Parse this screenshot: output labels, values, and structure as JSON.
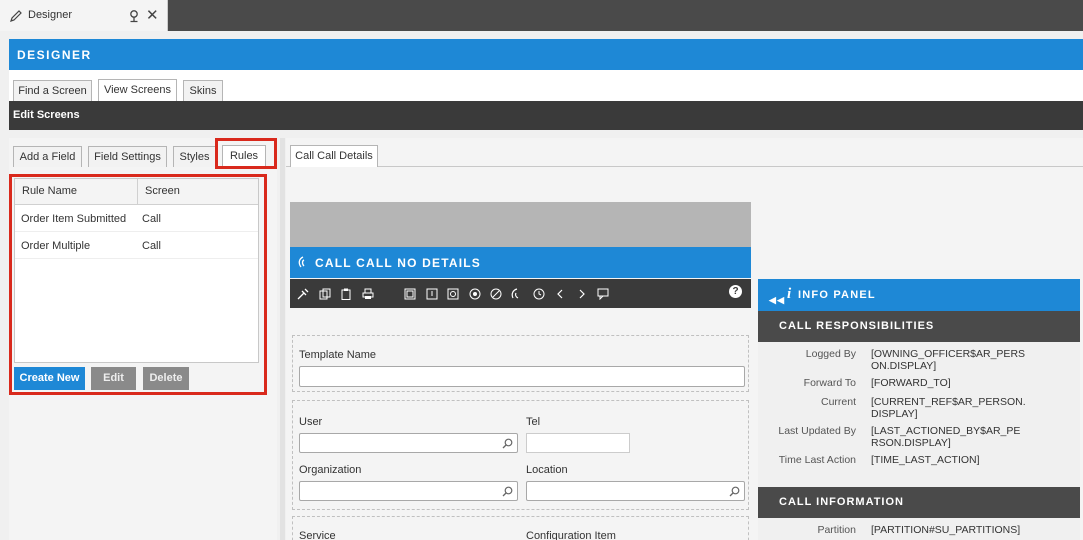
{
  "doc_tab": {
    "title": "Designer",
    "close": "✕"
  },
  "designer": {
    "title": "DESIGNER"
  },
  "main_tabs": [
    {
      "label": "Find a Screen"
    },
    {
      "label": "View Screens"
    },
    {
      "label": "Skins"
    }
  ],
  "edit_bar": {
    "title": "Edit Screens"
  },
  "left_tabs": [
    {
      "label": "Add a Field"
    },
    {
      "label": "Field Settings"
    },
    {
      "label": "Styles"
    },
    {
      "label": "Rules"
    }
  ],
  "rules_grid": {
    "columns": [
      "Rule Name",
      "Screen"
    ],
    "rows": [
      {
        "name": "Order Item Submitted",
        "screen": "Call"
      },
      {
        "name": "Order Multiple",
        "screen": "Call"
      }
    ]
  },
  "buttons": {
    "create": "Create New",
    "edit": "Edit",
    "delete": "Delete"
  },
  "right_tabs": [
    {
      "label": "Call Call Details"
    }
  ],
  "call_panel": {
    "title": "CALL CALL NO DETAILS",
    "help": "?"
  },
  "form": {
    "template_name": "Template Name",
    "user": "User",
    "tel": "Tel",
    "organization": "Organization",
    "location": "Location",
    "service": "Service",
    "configuration_item": "Configuration Item"
  },
  "info_panel": {
    "title": "INFO PANEL",
    "sections": [
      {
        "title": "CALL RESPONSIBILITIES",
        "items": [
          {
            "label": "Logged By",
            "value": "[OWNING_OFFICER$AR_PERSON.DISPLAY]"
          },
          {
            "label": "Forward To",
            "value": "[FORWARD_TO]"
          },
          {
            "label": "Current",
            "value": "[CURRENT_REF$AR_PERSON.DISPLAY]"
          },
          {
            "label": "Last Updated By",
            "value": "[LAST_ACTIONED_BY$AR_PERSON.DISPLAY]"
          },
          {
            "label": "Time Last Action",
            "value": "[TIME_LAST_ACTION]"
          }
        ]
      },
      {
        "title": "CALL INFORMATION",
        "items": [
          {
            "label": "Partition",
            "value": "[PARTITION#SU_PARTITIONS]"
          }
        ]
      }
    ]
  },
  "colors": {
    "accent": "#1e88d6",
    "dark_bar": "#3a3a3a",
    "highlight": "#d9291c"
  }
}
